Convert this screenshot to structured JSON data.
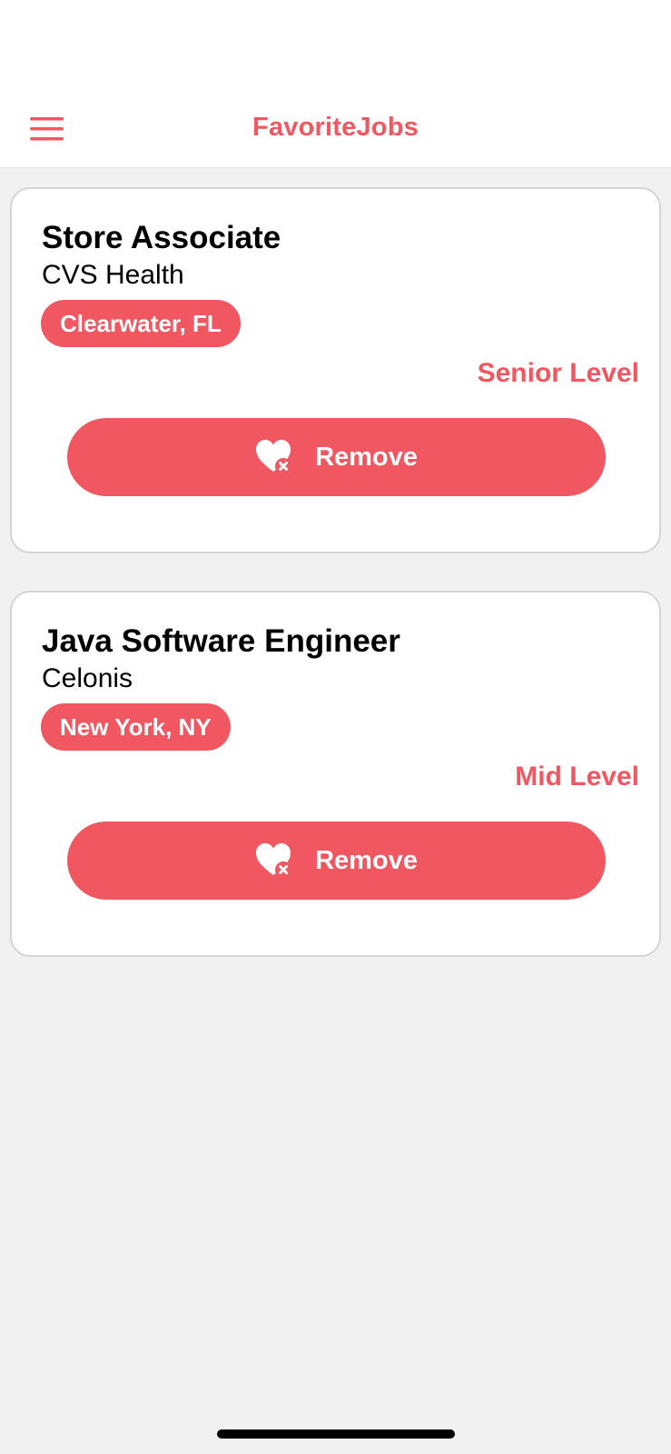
{
  "header": {
    "title": "FavoriteJobs",
    "menu_icon": "hamburger-menu-icon"
  },
  "jobs": [
    {
      "title": "Store Associate",
      "company": "CVS Health",
      "location": "Clearwater, FL",
      "level": "Senior Level",
      "remove_label": "Remove"
    },
    {
      "title": "Java Software Engineer",
      "company": "Celonis",
      "location": "New York, NY",
      "level": "Mid Level",
      "remove_label": "Remove"
    }
  ],
  "remove_icon": "heart-remove-icon",
  "colors": {
    "accent": "#f15760",
    "background": "#f1f1f1",
    "card": "#ffffff",
    "text": "#000000"
  }
}
